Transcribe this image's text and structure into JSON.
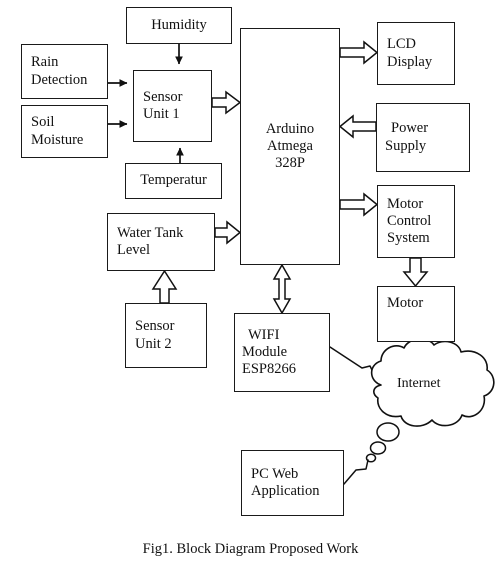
{
  "figure": {
    "caption": "Fig1. Block Diagram Proposed Work",
    "type": "block-diagram",
    "background_color": "#ffffff",
    "line_color": "#1a1a1a"
  },
  "nodes": {
    "humidity": {
      "label": "Humidity",
      "lines": [
        "Humidity"
      ]
    },
    "rain_detection": {
      "label": "Rain Detection",
      "lines": [
        "Rain",
        "Detection"
      ]
    },
    "soil_moisture": {
      "label": "Soil Moisture",
      "lines": [
        "Soil",
        "Moisture"
      ]
    },
    "sensor_unit_1": {
      "label": "Sensor Unit 1",
      "lines": [
        "Sensor",
        "Unit 1"
      ]
    },
    "temperatur": {
      "label": "Temperatur",
      "lines": [
        "Temperatur"
      ]
    },
    "water_tank_level": {
      "label": "Water Tank Level",
      "lines": [
        "Water Tank",
        "Level"
      ]
    },
    "sensor_unit_2": {
      "label": "Sensor Unit 2",
      "lines": [
        "Sensor",
        "Unit 2"
      ]
    },
    "arduino": {
      "label": "Arduino Atmega 328P",
      "lines": [
        "Arduino",
        "Atmega",
        "328P"
      ]
    },
    "lcd_display": {
      "label": "LCD Display",
      "lines": [
        "LCD",
        "Display"
      ]
    },
    "power_supply": {
      "label": "Power Supply",
      "lines": [
        "Power",
        "Supply"
      ]
    },
    "motor_control_system": {
      "label": "Motor Control System",
      "lines": [
        "Motor",
        "Control",
        "System"
      ]
    },
    "motor": {
      "label": "Motor",
      "lines": [
        "Motor"
      ]
    },
    "wifi_module": {
      "label": "WIFI Module ESP8266",
      "lines": [
        "WIFI",
        "Module",
        "ESP8266"
      ]
    },
    "internet": {
      "label": "Internet",
      "lines": [
        "Internet"
      ]
    },
    "pc_web_application": {
      "label": "PC Web Application",
      "lines": [
        "PC Web",
        "Application"
      ]
    }
  },
  "connections": [
    {
      "name": "humidity-to-sensor-unit-1",
      "from": "humidity",
      "to": "sensor_unit_1",
      "style": "thin-arrow",
      "direction": "down"
    },
    {
      "name": "rain-detection-to-sensor-unit-1",
      "from": "rain_detection",
      "to": "sensor_unit_1",
      "style": "thin-arrow",
      "direction": "right"
    },
    {
      "name": "soil-moisture-to-sensor-unit-1",
      "from": "soil_moisture",
      "to": "sensor_unit_1",
      "style": "thin-arrow",
      "direction": "right"
    },
    {
      "name": "temperatur-to-sensor-unit-1",
      "from": "temperatur",
      "to": "sensor_unit_1",
      "style": "thin-arrow",
      "direction": "up"
    },
    {
      "name": "sensor-unit-1-to-arduino",
      "from": "sensor_unit_1",
      "to": "arduino",
      "style": "block-arrow",
      "direction": "right"
    },
    {
      "name": "sensor-unit-2-to-water-tank-level",
      "from": "sensor_unit_2",
      "to": "water_tank_level",
      "style": "block-arrow",
      "direction": "up"
    },
    {
      "name": "water-tank-level-to-arduino",
      "from": "water_tank_level",
      "to": "arduino",
      "style": "block-arrow",
      "direction": "right"
    },
    {
      "name": "arduino-to-lcd-display",
      "from": "arduino",
      "to": "lcd_display",
      "style": "block-arrow",
      "direction": "right"
    },
    {
      "name": "power-supply-to-arduino",
      "from": "power_supply",
      "to": "arduino",
      "style": "block-arrow",
      "direction": "left"
    },
    {
      "name": "arduino-to-motor-control-system",
      "from": "arduino",
      "to": "motor_control_system",
      "style": "block-arrow",
      "direction": "right"
    },
    {
      "name": "motor-control-system-to-motor",
      "from": "motor_control_system",
      "to": "motor",
      "style": "block-arrow",
      "direction": "down"
    },
    {
      "name": "arduino-to-wifi-module",
      "from": "arduino",
      "to": "wifi_module",
      "style": "block-arrow",
      "direction": "bidirectional-vertical"
    },
    {
      "name": "wifi-module-to-internet",
      "from": "wifi_module",
      "to": "internet",
      "style": "tail-line",
      "direction": "none"
    },
    {
      "name": "internet-to-pc-web-application",
      "from": "internet",
      "to": "pc_web_application",
      "style": "bubble-tail",
      "direction": "none"
    }
  ]
}
